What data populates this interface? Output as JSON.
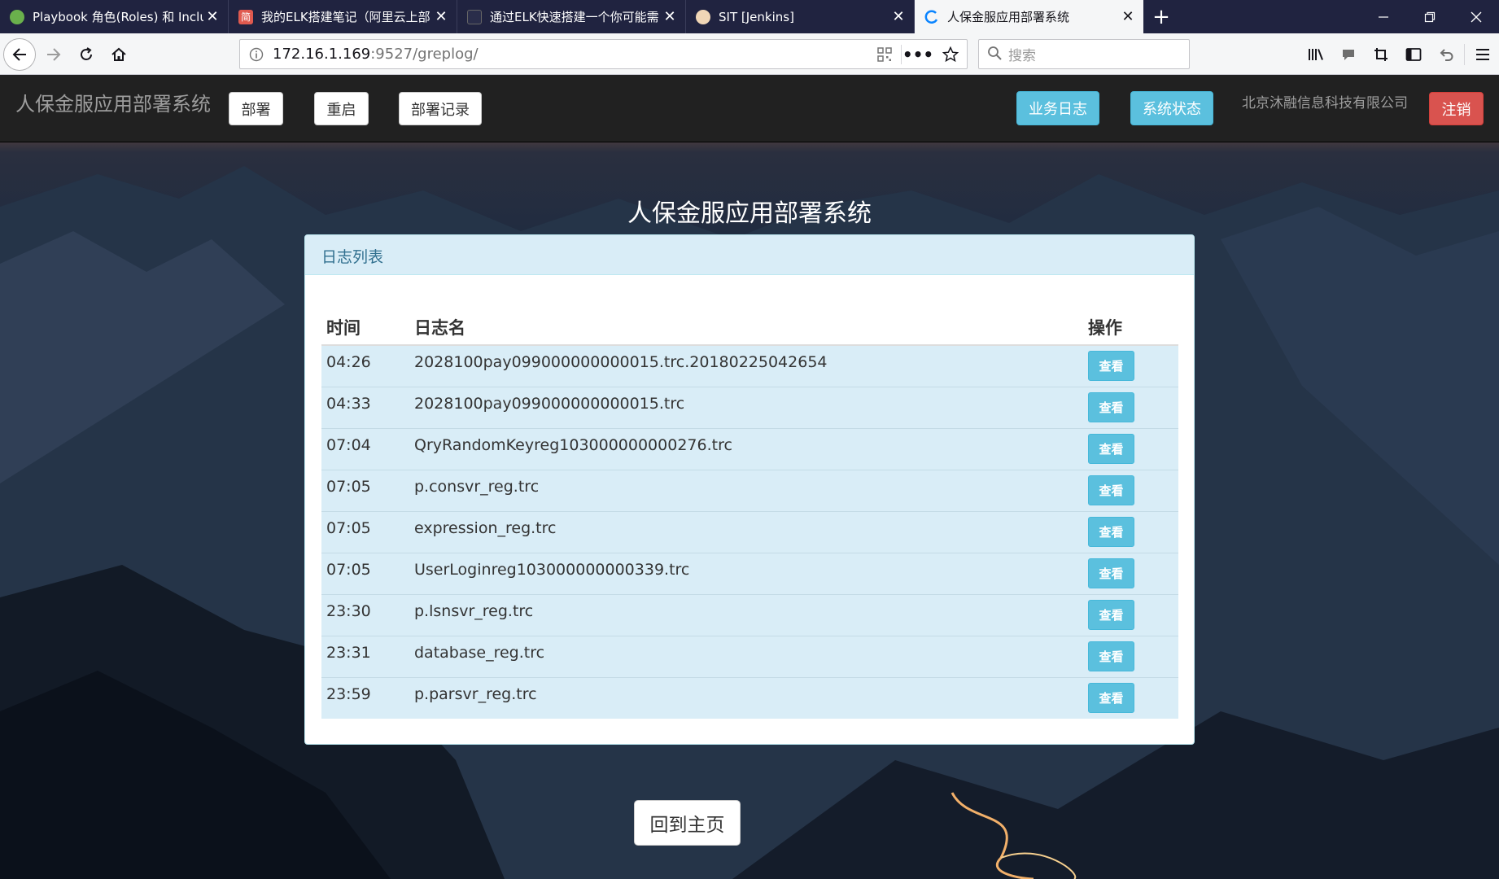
{
  "browser": {
    "tabs": [
      {
        "title": "Playbook 角色(Roles) 和 Inclu",
        "active": false
      },
      {
        "title": "我的ELK搭建笔记（阿里云上部",
        "active": false,
        "favicon_text": "简"
      },
      {
        "title": "通过ELK快速搭建一个你可能需",
        "active": false
      },
      {
        "title": "SIT [Jenkins]",
        "active": false
      },
      {
        "title": "人保金服应用部署系统",
        "active": true
      }
    ],
    "url_host": "172.16.1.169",
    "url_path": ":9527/greplog/",
    "search_placeholder": "搜索"
  },
  "app": {
    "brand": "人保金服应用部署系统",
    "nav_buttons": [
      "部署",
      "重启",
      "部署记录"
    ],
    "right_buttons": [
      "业务日志",
      "系统状态"
    ],
    "company": "北京沐融信息科技有限公司",
    "logout": "注销"
  },
  "main": {
    "heading": "人保金服应用部署系统",
    "panel_title": "日志列表",
    "columns": [
      "时间",
      "日志名",
      "操作"
    ],
    "view_label": "查看",
    "rows": [
      {
        "time": "04:26",
        "name": "2028100pay099000000000015.trc.20180225042654"
      },
      {
        "time": "04:33",
        "name": "2028100pay099000000000015.trc"
      },
      {
        "time": "07:04",
        "name": "QryRandomKeyreg103000000000276.trc"
      },
      {
        "time": "07:05",
        "name": "p.consvr_reg.trc"
      },
      {
        "time": "07:05",
        "name": "expression_reg.trc"
      },
      {
        "time": "07:05",
        "name": "UserLoginreg103000000000339.trc"
      },
      {
        "time": "23:30",
        "name": "p.lsnsvr_reg.trc"
      },
      {
        "time": "23:31",
        "name": "database_reg.trc"
      },
      {
        "time": "23:59",
        "name": "p.parsvr_reg.trc"
      }
    ],
    "home_button": "回到主页"
  },
  "colors": {
    "info": "#5bc0de",
    "danger": "#d9534f",
    "navbar": "#212121",
    "panel_heading": "#d9edf7"
  }
}
